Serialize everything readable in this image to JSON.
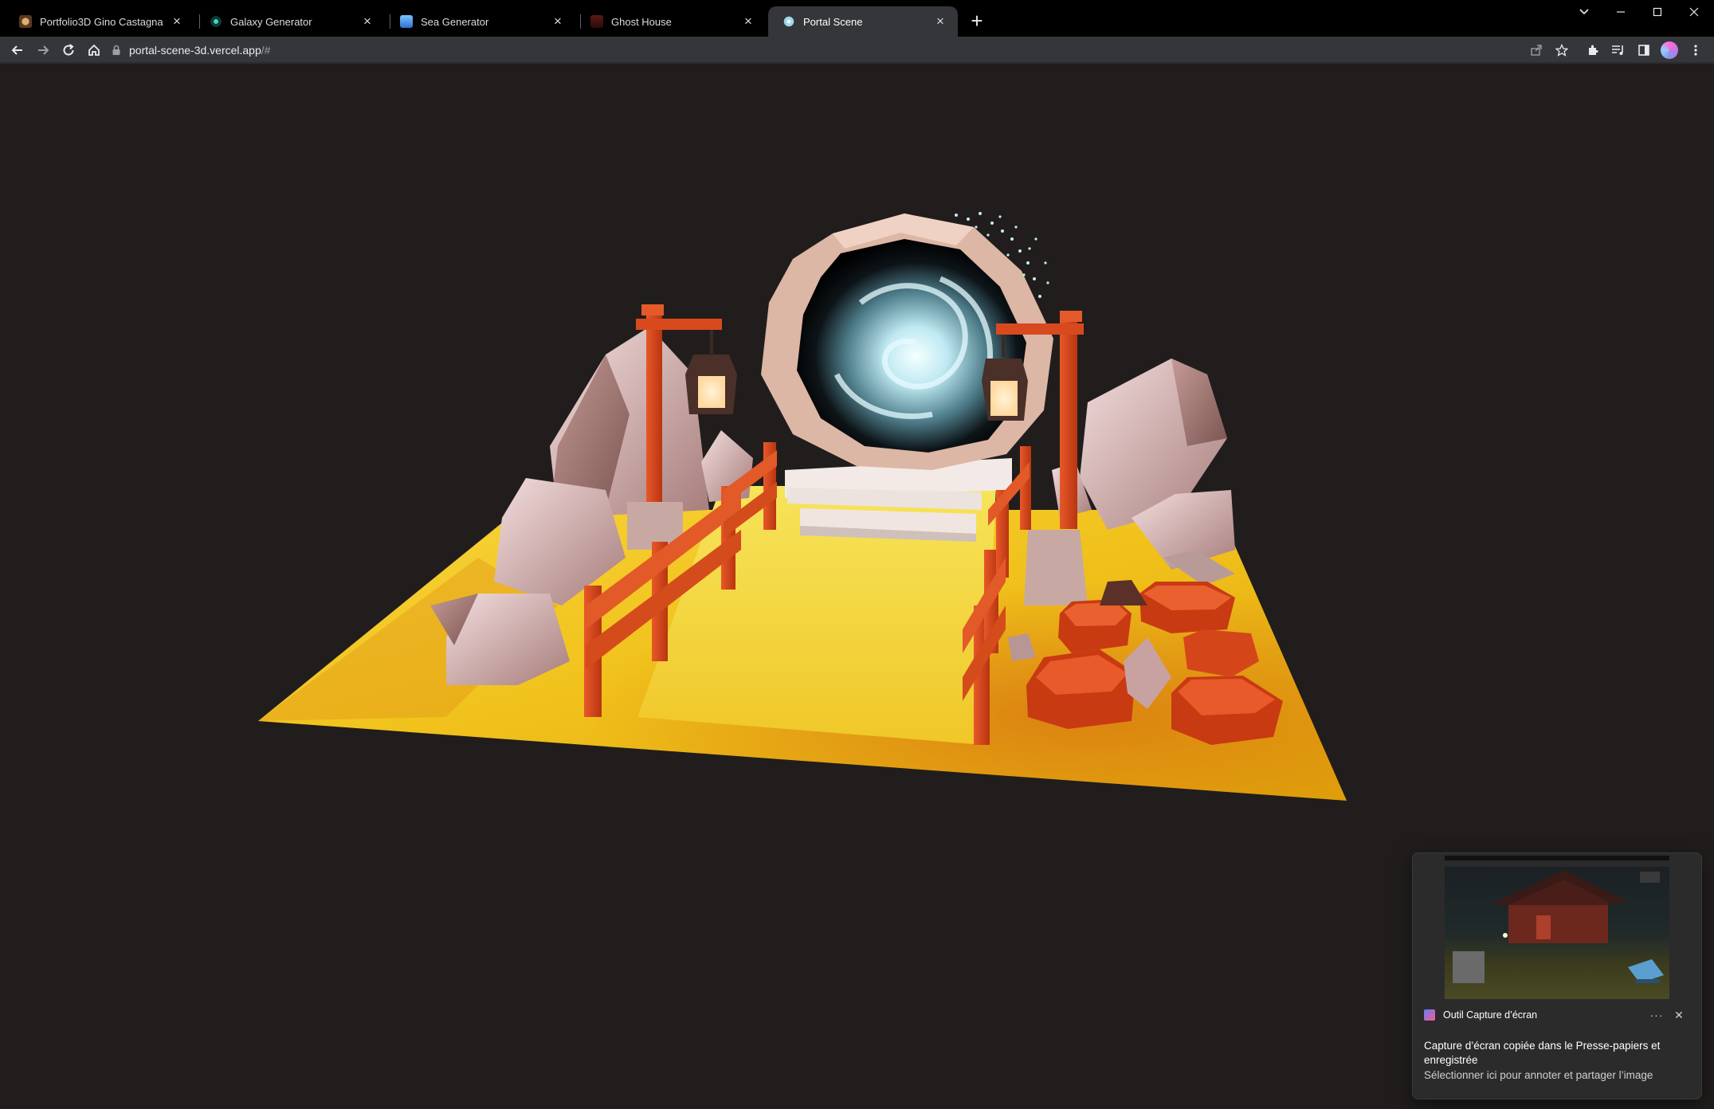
{
  "browser": {
    "tabs": [
      {
        "title": "Portfolio3D Gino Castagna",
        "active": false,
        "favicon_color": "#c8a060"
      },
      {
        "title": "Galaxy Generator",
        "active": false,
        "favicon_color": "#2fb3a3"
      },
      {
        "title": "Sea Generator",
        "active": false,
        "favicon_color": "#3b8fe0"
      },
      {
        "title": "Ghost House",
        "active": false,
        "favicon_color": "#7a2a24"
      },
      {
        "title": "Portal Scene",
        "active": true,
        "favicon_color": "#bfe6ef"
      }
    ],
    "address": {
      "host": "portal-scene-3d.vercel.app",
      "path": "/#"
    }
  },
  "toast": {
    "app_name": "Outil Capture d’écran",
    "title": "Capture d’écran copiée dans le Presse-papiers et enregistrée",
    "body": "Sélectionner ici pour annoter et partager l’image",
    "more_label": "···",
    "close_label": "✕"
  },
  "colors": {
    "page_bg": "#211d1d",
    "ground": "#f2c21c",
    "wood": "#d9471d",
    "stone": "#e8cfc7",
    "portal_glow": "#bfeef5"
  }
}
